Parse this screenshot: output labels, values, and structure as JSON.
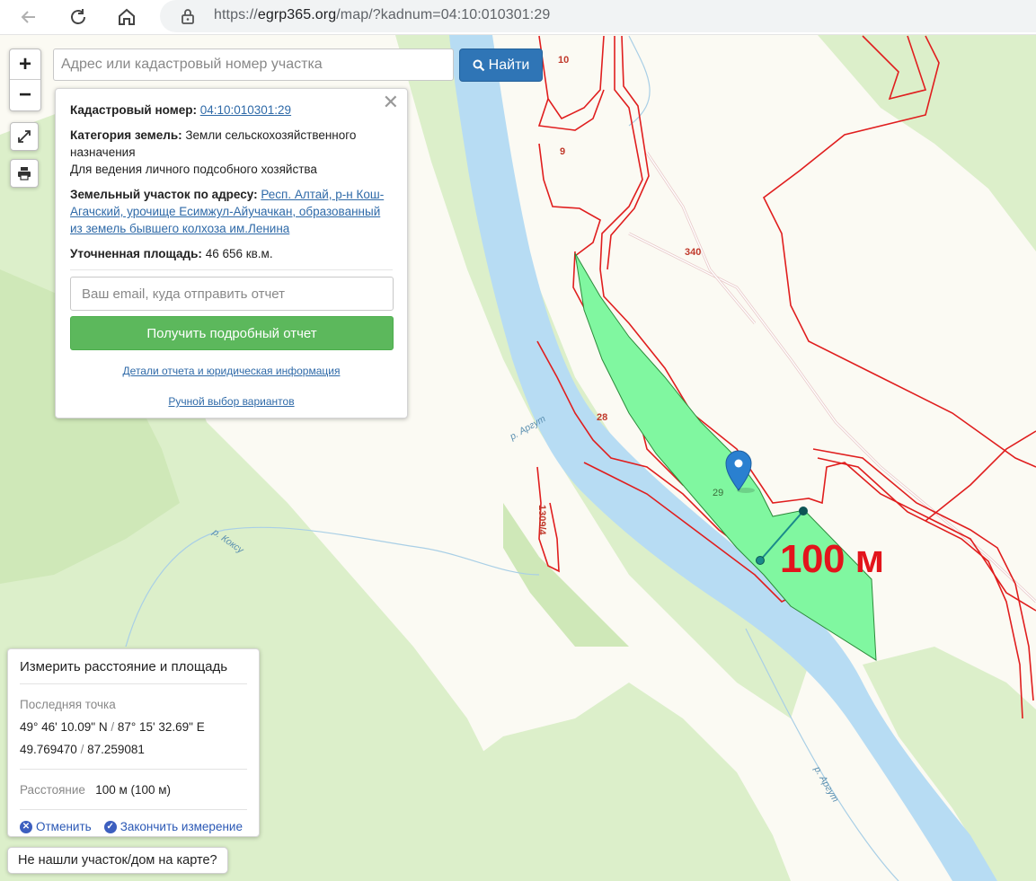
{
  "browser": {
    "url_scheme": "https://",
    "url_host": "egrp365.org",
    "url_path": "/map/?kadnum=04:10:010301:29"
  },
  "search": {
    "placeholder": "Адрес или кадастровый номер участка",
    "button_label": "Найти"
  },
  "zoom": {
    "in": "+",
    "out": "−"
  },
  "popup": {
    "cadnum_label": "Кадастровый номер:",
    "cadnum_value": "04:10:010301:29",
    "category_label": "Категория земель:",
    "category_value": "Земли сельскохозяйственного назначения",
    "usage": "Для ведения личного подсобного хозяйства",
    "address_label": "Земельный участок по адресу:",
    "address_value": "Респ. Алтай, р-н Кош-Агачский, урочище Есимжул-Айучачкан, образованный из земель бывшего колхоза им.Ленина",
    "area_label": "Уточненная площадь:",
    "area_value": "46 656 кв.м.",
    "email_placeholder": "Ваш email, куда отправить отчет",
    "report_button": "Получить подробный отчет",
    "details_link": "Детали отчета и юридическая информация",
    "manual_link": "Ручной выбор вариантов"
  },
  "measure": {
    "title": "Измерить расстояние и площадь",
    "last_point_label": "Последняя точка",
    "coords_dms_lat": "49° 46' 10.09\" N",
    "coords_sep": " / ",
    "coords_dms_lon": "87° 15' 32.69\" E",
    "coords_dec_lat": "49.769470",
    "coords_dec_lon": "87.259081",
    "distance_label": "Расстояние",
    "distance_value": "100 м (100 м)",
    "cancel": "Отменить",
    "finish": "Закончить измерение"
  },
  "not_found": "Не нашли участок/дом на карте?",
  "map": {
    "parcel_labels": [
      "10",
      "9",
      "340",
      "28",
      "29",
      "1309/4"
    ],
    "river_labels": [
      "р. Аргут",
      "р. Коксу",
      "р. Аргут"
    ],
    "measure_overlay": "100 м",
    "colors": {
      "river": "#b7dcf3",
      "forest": "#dcefca",
      "land": "#fbfaf3",
      "parcel_border": "#e01e1e",
      "selected_parcel": "#80f7a0",
      "measure_line": "#1a8a8a",
      "overlay_text": "#e3141c"
    }
  }
}
